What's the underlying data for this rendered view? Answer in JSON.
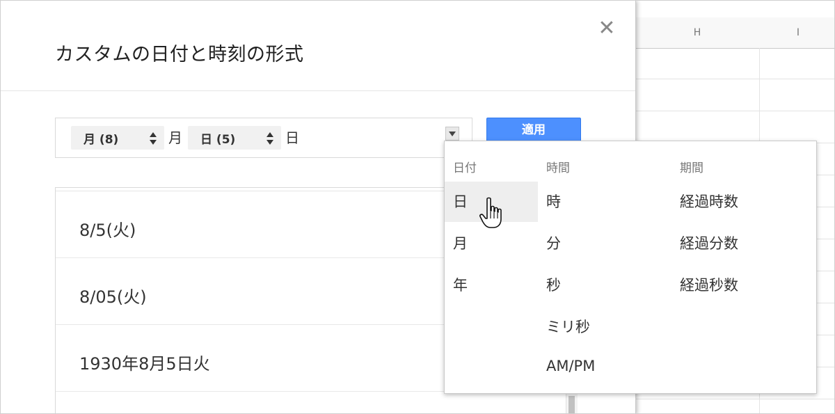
{
  "sheet": {
    "columns": [
      "H",
      "I"
    ]
  },
  "dialog": {
    "title": "カスタムの日付と時刻の形式",
    "close_glyph": "✕",
    "format_parts": {
      "chip1": "月 (8)",
      "sep1": "月",
      "chip2": "日 (5)",
      "sep2": "日"
    },
    "apply_label": "適用",
    "examples": [
      "8/5(火)",
      "8/05(火)",
      "1930年8月5日火"
    ]
  },
  "menu": {
    "headers": {
      "date": "日付",
      "time": "時間",
      "duration": "期間"
    },
    "date_items": [
      "日",
      "月",
      "年"
    ],
    "time_items": [
      "時",
      "分",
      "秒",
      "ミリ秒",
      "AM/PM"
    ],
    "duration_items": [
      "経過時数",
      "経過分数",
      "経過秒数"
    ],
    "hovered_item": "日"
  },
  "colors": {
    "accent": "#4d90fe",
    "hover": "#eeeeee"
  }
}
